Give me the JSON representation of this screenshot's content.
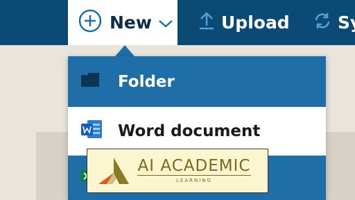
{
  "toolbar": {
    "new_label": "New",
    "upload_label": "Upload",
    "sync_label": "Sy"
  },
  "menu": {
    "items": [
      {
        "label": "Folder",
        "icon": "folder-icon"
      },
      {
        "label": "Word document",
        "icon": "word-icon"
      },
      {
        "label": "",
        "icon": "excel-icon"
      }
    ]
  },
  "watermark": {
    "brand": "AI ACADEMIC",
    "tagline": "LEARNING"
  },
  "colors": {
    "topbar": "#0b4a74",
    "menu_selected": "#1f6ea8",
    "background": "#e9e4dc"
  }
}
